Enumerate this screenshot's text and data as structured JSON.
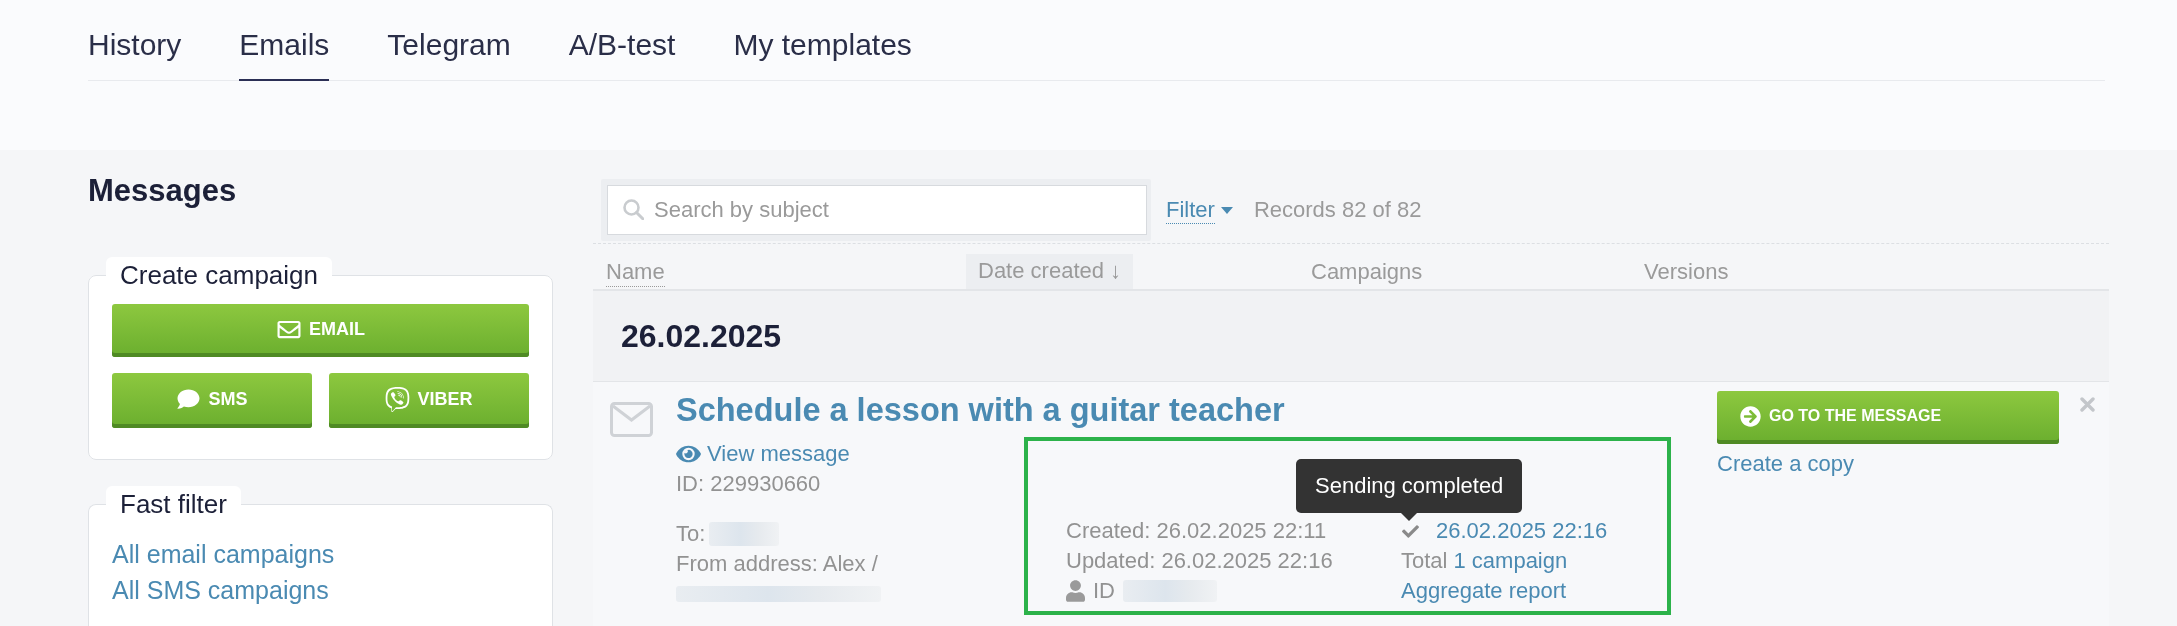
{
  "tabs": [
    {
      "label": "History",
      "selected": false
    },
    {
      "label": "Emails",
      "selected": true
    },
    {
      "label": "Telegram",
      "selected": false
    },
    {
      "label": "A/B-test",
      "selected": false
    },
    {
      "label": "My templates",
      "selected": false
    }
  ],
  "sidebar": {
    "title": "Messages",
    "create_campaign": {
      "title": "Create campaign",
      "buttons": [
        {
          "kind": "email",
          "label": "EMAIL"
        },
        {
          "kind": "sms",
          "label": "SMS"
        },
        {
          "kind": "viber",
          "label": "VIBER"
        }
      ]
    },
    "fast_filter": {
      "title": "Fast filter",
      "links": [
        "All email campaigns",
        "All SMS campaigns"
      ]
    }
  },
  "toolbar": {
    "search": {
      "placeholder": "Search by subject"
    },
    "filter": "Filter",
    "records": "Records 82 of 82"
  },
  "table": {
    "columns": [
      {
        "label": "Name",
        "sortable": true,
        "selected": false
      },
      {
        "label": "Date created ↓",
        "sortable": false,
        "selected": true
      },
      {
        "label": "Campaigns",
        "sortable": false,
        "selected": false
      },
      {
        "label": "Versions",
        "sortable": false,
        "selected": false
      }
    ],
    "groups": [
      {
        "date": "26.02.2025",
        "messages": [
          {
            "title": "Schedule a lesson with a guitar teacher",
            "view_link": "View message",
            "id": "ID: 229930660",
            "to": "To:",
            "from": "From address: Alex /",
            "created": "Created: 26.02.2025 22:11",
            "updated": "Updated: 26.02.2025 22:16",
            "author": "ID",
            "sent": "26.02.2025 22:16",
            "sent_tooltip": "Sending completed",
            "total": "Total",
            "campaigns": "1 campaign",
            "report": "Aggregate report",
            "highlighted": true,
            "open_button": "GO TO THE MESSAGE",
            "copy_link": "Create a copy"
          }
        ]
      }
    ]
  }
}
